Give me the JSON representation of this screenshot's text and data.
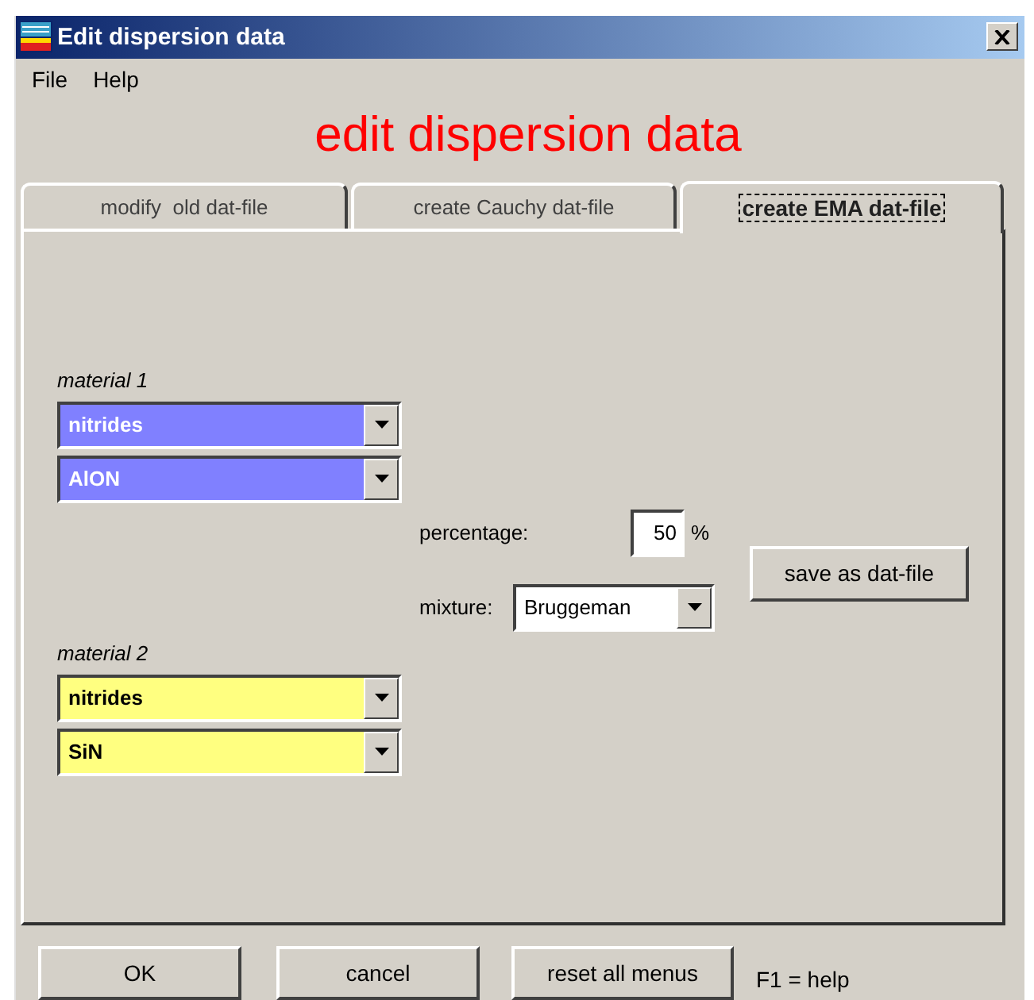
{
  "window": {
    "title": "Edit dispersion data"
  },
  "menu": [
    "File",
    "Help"
  ],
  "heading": "edit dispersion data",
  "tabs": [
    {
      "label": "modify  old dat-file",
      "selected": false
    },
    {
      "label": "create Cauchy dat-file",
      "selected": false
    },
    {
      "label": "create EMA dat-file",
      "selected": true
    }
  ],
  "materials": [
    {
      "label": "material 1",
      "color": "#8080ff",
      "combos": [
        "nitrides",
        "AlON"
      ]
    },
    {
      "label": "material 2",
      "color": "#ffff80",
      "combos": [
        "nitrides",
        "SiN"
      ]
    }
  ],
  "percentage": {
    "label": "percentage:",
    "value": "50",
    "unit": "%"
  },
  "mixture": {
    "label": "mixture:",
    "value": "Bruggeman"
  },
  "save_button": "save as dat-file",
  "buttons": [
    "OK",
    "cancel",
    "reset all menus"
  ],
  "help_hint": "F1 = help"
}
